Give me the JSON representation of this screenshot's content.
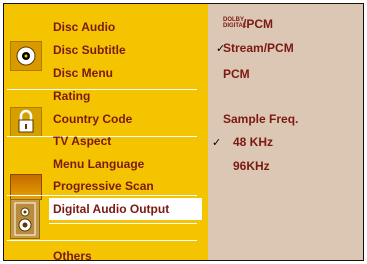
{
  "menu": {
    "items": [
      {
        "label": "Disc Audio"
      },
      {
        "label": "Disc Subtitle"
      },
      {
        "label": "Disc Menu"
      },
      {
        "label": "Rating"
      },
      {
        "label": "Country Code"
      },
      {
        "label": "TV Aspect"
      },
      {
        "label": "Menu Language"
      },
      {
        "label": "Progressive Scan"
      },
      {
        "label": "Digital Audio Output",
        "selected": true
      },
      {
        "label": "Others"
      }
    ]
  },
  "options": {
    "dolby_logo": [
      "DOLBY",
      "DIGITAL"
    ],
    "dolby_pcm": "/PCM",
    "stream_pcm": "Stream/PCM",
    "pcm": "PCM",
    "sample_freq_title": "Sample Freq.",
    "freq_48": "48 KHz",
    "freq_96": "96KHz",
    "checkmark": "✓"
  },
  "colors": {
    "panel_yellow": "#f4c400",
    "text_maroon": "#7a1a12",
    "submenu_bg": "#dcc7b4",
    "frame_brown": "#9a7714",
    "selection_white": "#ffffff"
  },
  "icons": [
    "disc-icon",
    "lock-icon",
    "screen-icon",
    "speaker-icon",
    "check-icon"
  ]
}
